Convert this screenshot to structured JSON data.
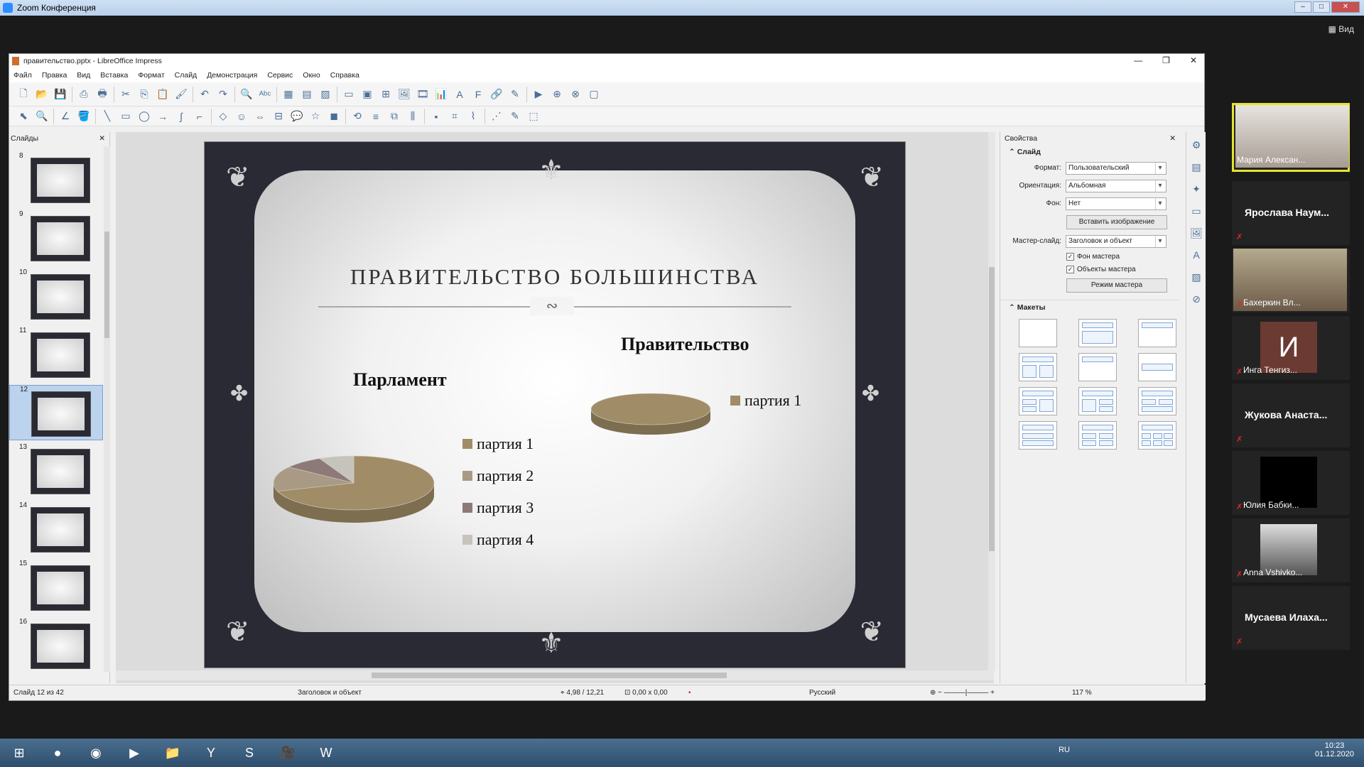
{
  "zoom": {
    "window_title": "Zoom Конференция",
    "view_label": "Вид"
  },
  "lo": {
    "title": "правительство.pptx - LibreOffice Impress",
    "menu": [
      "Файл",
      "Правка",
      "Вид",
      "Вставка",
      "Формат",
      "Слайд",
      "Демонстрация",
      "Сервис",
      "Окно",
      "Справка"
    ],
    "slides_panel_title": "Слайды",
    "thumb_numbers": [
      "8",
      "9",
      "10",
      "11",
      "12",
      "13",
      "14",
      "15",
      "16"
    ],
    "selected_slide": "12"
  },
  "slide": {
    "title": "ПРАВИТЕЛЬСТВО БОЛЬШИНСТВА",
    "parliament_title": "Парламент",
    "government_title": "Правительство",
    "parliament_legend": [
      "партия 1",
      "партия 2",
      "партия 3",
      "партия 4"
    ],
    "government_legend": [
      "партия 1"
    ],
    "colors": {
      "p1": "#a08d67",
      "p2": "#a89a84",
      "p3": "#8d7a78",
      "p4": "#c6c3bc"
    }
  },
  "chart_data": [
    {
      "type": "pie",
      "title": "Парламент",
      "categories": [
        "партия 1",
        "партия 2",
        "партия 3",
        "партия 4"
      ],
      "values": [
        70,
        15,
        8,
        7
      ]
    },
    {
      "type": "pie",
      "title": "Правительство",
      "categories": [
        "партия 1"
      ],
      "values": [
        100
      ]
    }
  ],
  "props": {
    "panel_title": "Свойства",
    "slide_section": "Слайд",
    "format_label": "Формат:",
    "format_value": "Пользовательский",
    "orientation_label": "Ориентация:",
    "orientation_value": "Альбомная",
    "background_label": "Фон:",
    "background_value": "Нет",
    "insert_image_btn": "Вставить изображение",
    "master_label": "Мастер-слайд:",
    "master_value": "Заголовок и объект",
    "master_bg_chk": "Фон мастера",
    "master_obj_chk": "Объекты мастера",
    "master_mode_btn": "Режим мастера",
    "layouts_section": "Макеты"
  },
  "status": {
    "slide_pos": "Слайд 12 из 42",
    "layout_name": "Заголовок и объект",
    "coords": "4,98 / 12,21",
    "size": "0,00 x 0,00",
    "language": "Русский",
    "zoom": "117 %"
  },
  "participants": [
    {
      "name": "Мария Алексан..."
    },
    {
      "name": "Ярослава  Наум..."
    },
    {
      "name": "Бахеркин Вл..."
    },
    {
      "name": "Инга Тенгиз...",
      "initial": "И"
    },
    {
      "name": "Жукова  Анаста..."
    },
    {
      "name": "Юлия Бабки..."
    },
    {
      "name": "Anna Vshivko..."
    },
    {
      "name": "Мусаева  Илаха..."
    }
  ],
  "tray": {
    "lang": "RU",
    "time": "10:23",
    "date": "01.12.2020"
  }
}
